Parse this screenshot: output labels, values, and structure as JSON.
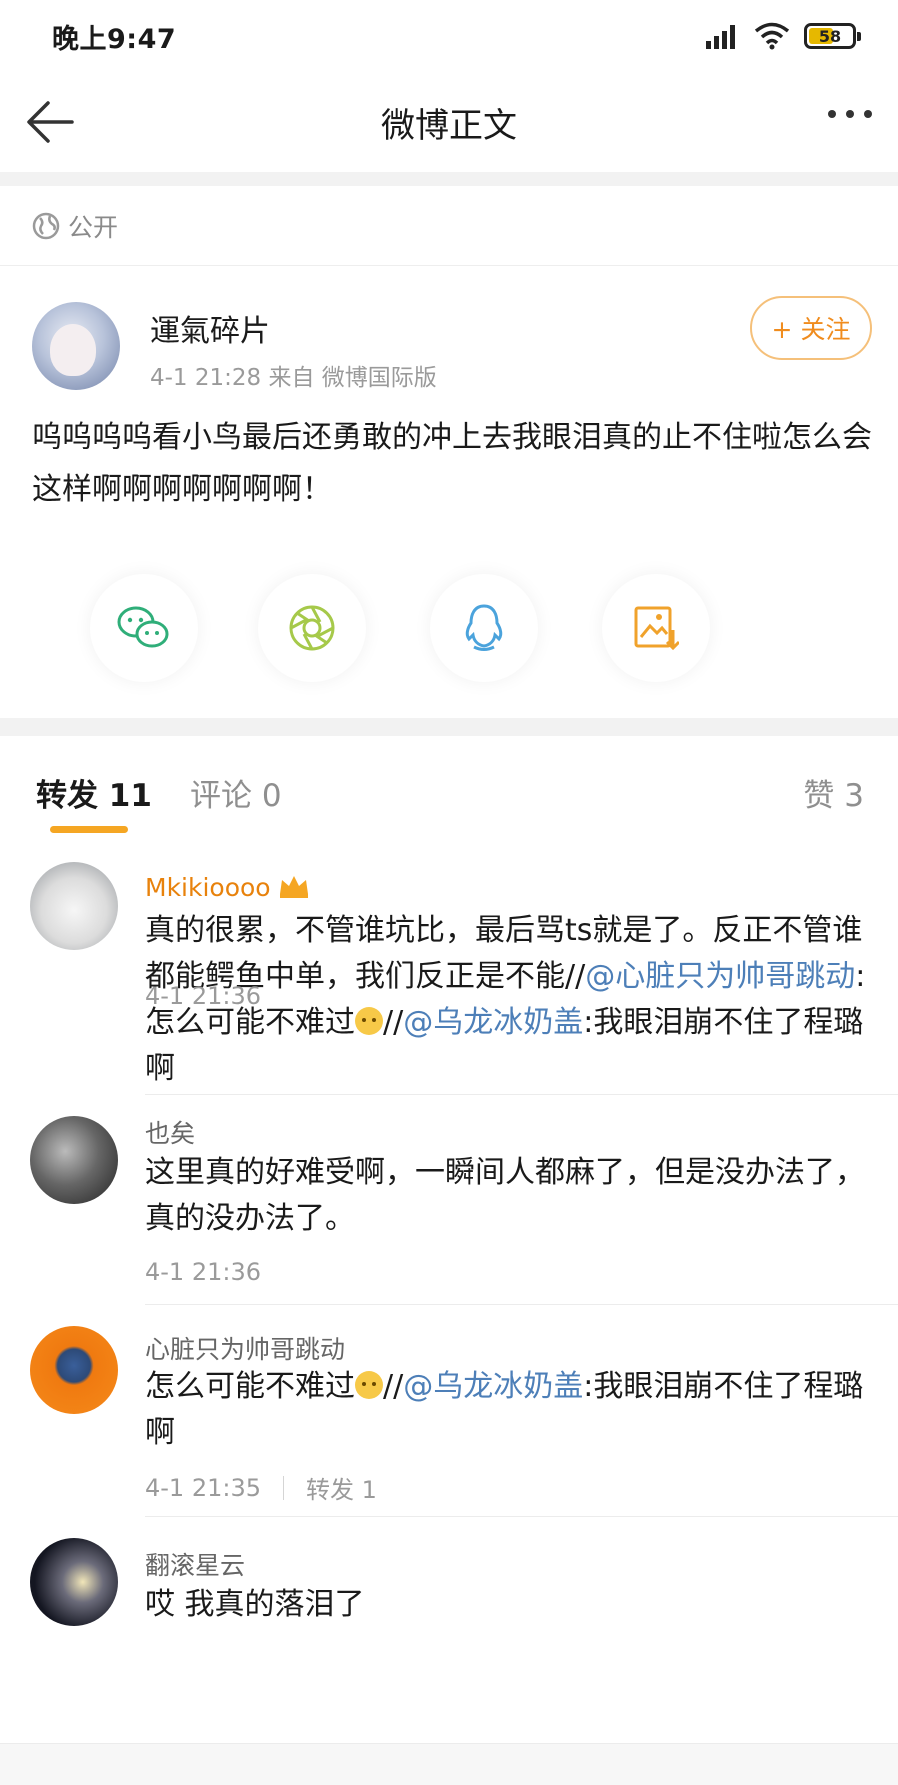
{
  "status_bar": {
    "time": "晚上9:47",
    "battery": "58",
    "battery_level": 0.58
  },
  "nav": {
    "title": "微博正文"
  },
  "privacy": {
    "label": "公开"
  },
  "post": {
    "author": "運氣碎片",
    "meta": "4-1 21:28  来自 微博国际版",
    "follow_label": "+ 关注",
    "text": "呜呜呜呜看小鸟最后还勇敢的冲上去我眼泪真的止不住啦怎么会这样啊啊啊啊啊啊啊！"
  },
  "share_icons": [
    "wechat-icon",
    "moments-icon",
    "qq-icon",
    "save-image-icon"
  ],
  "tabs": {
    "repost": "转发 11",
    "comment": "评论 0",
    "like": "赞 3"
  },
  "colors": {
    "accent": "#f5a623",
    "link": "#4d7fb8",
    "vip_name": "#e8820c",
    "follow": "#f08c1e"
  },
  "comments": [
    {
      "user": "Mkikioooo",
      "segments": [
        {
          "t": "真的很累，不管谁坑比，最后骂ts就是了。反正不管谁都能鳄鱼中单，我们反正是不能//"
        },
        {
          "t": "@心脏只为帅哥跳动",
          "link": true
        },
        {
          "t": ":怎么可能不难过"
        },
        {
          "emoji": true
        },
        {
          "t": "//"
        },
        {
          "t": "@乌龙冰奶盖",
          "link": true
        },
        {
          "t": ":我眼泪崩不住了程璐啊"
        }
      ],
      "time": "4-1 21:36"
    },
    {
      "user": "也矣",
      "segments": [
        {
          "t": "这里真的好难受啊，一瞬间人都麻了，但是没办法了，真的没办法了。"
        }
      ],
      "time": "4-1 21:36"
    },
    {
      "user": "心脏只为帅哥跳动",
      "segments": [
        {
          "t": "怎么可能不难过"
        },
        {
          "emoji": true
        },
        {
          "t": "//"
        },
        {
          "t": "@乌龙冰奶盖",
          "link": true
        },
        {
          "t": ":我眼泪崩不住了程璐啊"
        }
      ],
      "time": "4-1 21:35",
      "extra": "转发 1"
    },
    {
      "user": "翻滚星云",
      "segments": [
        {
          "t": "哎 我真的落泪了"
        }
      ],
      "time": ""
    }
  ]
}
